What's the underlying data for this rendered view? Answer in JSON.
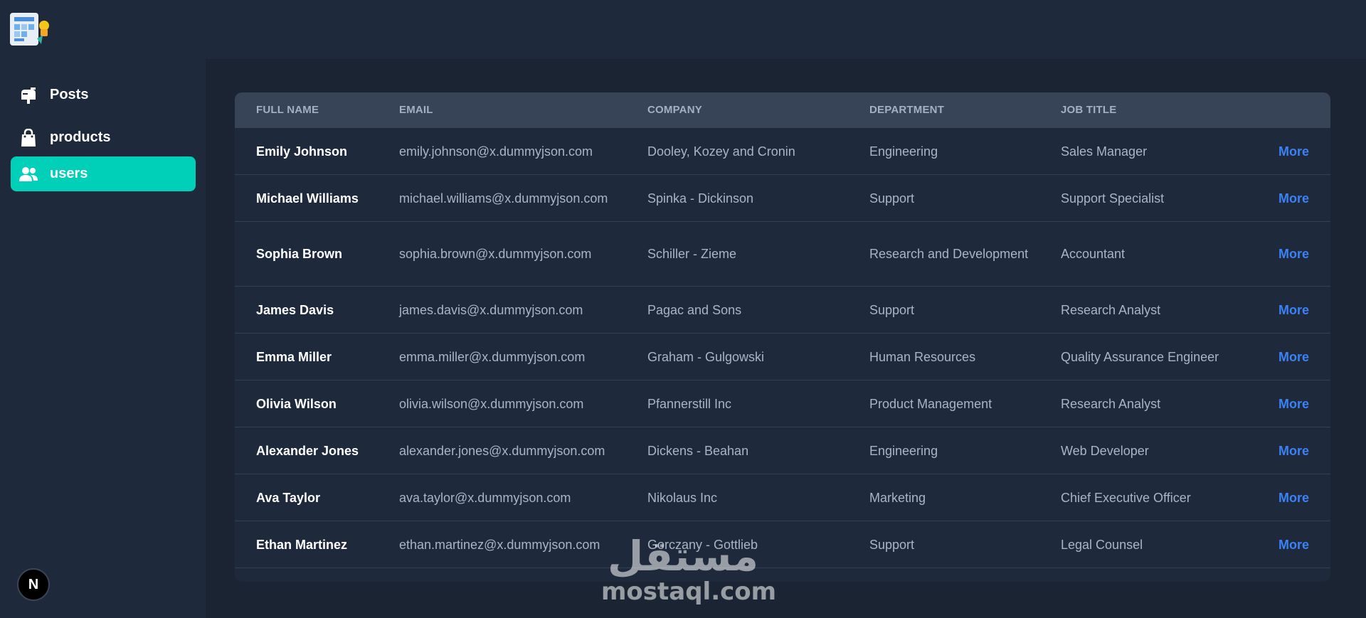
{
  "app": {
    "logo_icon": "dashboard-illustration-icon"
  },
  "sidebar": {
    "items": [
      {
        "label": "Posts",
        "icon": "mailbox-icon",
        "active": false
      },
      {
        "label": "products",
        "icon": "shopping-bag-icon",
        "active": false
      },
      {
        "label": "users",
        "icon": "users-icon",
        "active": true
      }
    ],
    "footer_badge": "N"
  },
  "table": {
    "columns": [
      "FULL NAME",
      "EMAIL",
      "COMPANY",
      "DEPARTMENT",
      "JOB TITLE"
    ],
    "action_label": "More",
    "rows": [
      {
        "name": "Emily Johnson",
        "email": "emily.johnson@x.dummyjson.com",
        "company": "Dooley, Kozey and Cronin",
        "department": "Engineering",
        "job_title": "Sales Manager"
      },
      {
        "name": "Michael Williams",
        "email": "michael.williams@x.dummyjson.com",
        "company": "Spinka - Dickinson",
        "department": "Support",
        "job_title": "Support Specialist"
      },
      {
        "name": "Sophia Brown",
        "email": "sophia.brown@x.dummyjson.com",
        "company": "Schiller - Zieme",
        "department": "Research and Development",
        "job_title": "Accountant"
      },
      {
        "name": "James Davis",
        "email": "james.davis@x.dummyjson.com",
        "company": "Pagac and Sons",
        "department": "Support",
        "job_title": "Research Analyst"
      },
      {
        "name": "Emma Miller",
        "email": "emma.miller@x.dummyjson.com",
        "company": "Graham - Gulgowski",
        "department": "Human Resources",
        "job_title": "Quality Assurance Engineer"
      },
      {
        "name": "Olivia Wilson",
        "email": "olivia.wilson@x.dummyjson.com",
        "company": "Pfannerstill Inc",
        "department": "Product Management",
        "job_title": "Research Analyst"
      },
      {
        "name": "Alexander Jones",
        "email": "alexander.jones@x.dummyjson.com",
        "company": "Dickens - Beahan",
        "department": "Engineering",
        "job_title": "Web Developer"
      },
      {
        "name": "Ava Taylor",
        "email": "ava.taylor@x.dummyjson.com",
        "company": "Nikolaus Inc",
        "department": "Marketing",
        "job_title": "Chief Executive Officer"
      },
      {
        "name": "Ethan Martinez",
        "email": "ethan.martinez@x.dummyjson.com",
        "company": "Gorczany - Gottlieb",
        "department": "Support",
        "job_title": "Legal Counsel"
      }
    ]
  },
  "watermark": {
    "arabic": "مستقل",
    "latin": "mostaql.com"
  },
  "colors": {
    "accent": "#00d0b8",
    "link": "#3b82f6",
    "background": "#1b2433",
    "panel": "#1e293b",
    "header": "#374357"
  }
}
